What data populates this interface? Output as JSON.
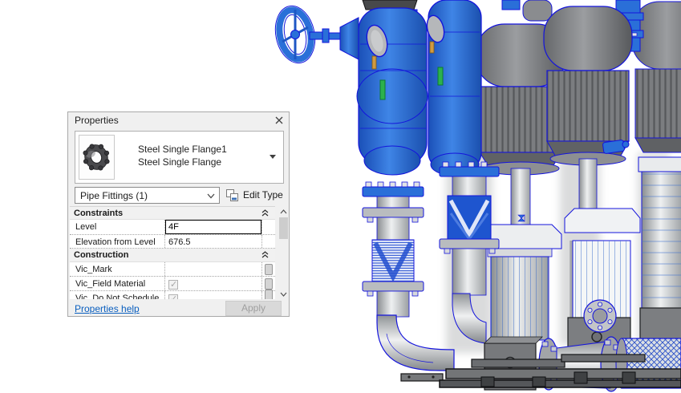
{
  "window": {
    "title": "Properties"
  },
  "type_selector": {
    "family": "Steel Single Flange1",
    "type_name": "Steel Single Flange"
  },
  "filter_combo": {
    "value": "Pipe Fittings (1)"
  },
  "edit_type": {
    "label": "Edit Type"
  },
  "groups": {
    "constraints": {
      "label": "Constraints"
    },
    "construction": {
      "label": "Construction"
    }
  },
  "rows": {
    "level": {
      "label": "Level",
      "value": "4F"
    },
    "elevation": {
      "label": "Elevation from Level",
      "value": "676.5"
    },
    "vic_mark": {
      "label": "Vic_Mark",
      "value": ""
    },
    "vic_field_material": {
      "label": "Vic_Field Material",
      "checked": true
    },
    "vic_do_not_schedule": {
      "label": "Vic_Do Not Schedule",
      "checked": true
    }
  },
  "footer": {
    "help": "Properties help",
    "apply": "Apply"
  },
  "icons": {
    "check": "✓"
  },
  "colors": {
    "selection_blue": "#2a6fd8",
    "edge_blue": "#1414dc",
    "panel_bg": "#f0f0f0",
    "link_blue": "#0a5fbf",
    "motor_grey": "#7b7d80",
    "pipe_grey": "#aeb2b5"
  }
}
